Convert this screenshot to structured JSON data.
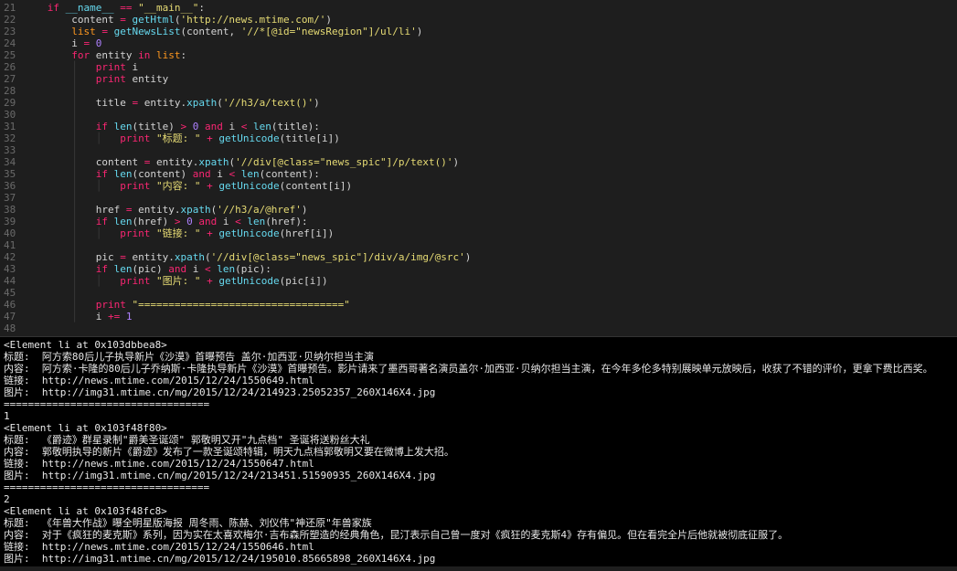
{
  "editor": {
    "lines": [
      {
        "n": "21",
        "html": "    <span class='kw'>if</span> <span class='fn'>__name__</span> <span class='op'>==</span> <span class='str'>\"__main__\"</span>:"
      },
      {
        "n": "22",
        "html": "        content <span class='op'>=</span> <span class='fn'>getHtml</span>(<span class='str'>'http://news.mtime.com/'</span>)"
      },
      {
        "n": "23",
        "html": "        <span class='name'>list</span> <span class='op'>=</span> <span class='fn'>getNewsList</span>(content, <span class='str'>'//*[@id=\"newsRegion\"]/ul/li'</span>)"
      },
      {
        "n": "24",
        "html": "        i <span class='op'>=</span> <span class='num'>0</span>"
      },
      {
        "n": "25",
        "html": "        <span class='kw'>for</span> entity <span class='kw'>in</span> <span class='name'>list</span>:"
      },
      {
        "n": "26",
        "html": "        <span class='guide'>│</span>   <span class='kw'>print</span> i"
      },
      {
        "n": "27",
        "html": "        <span class='guide'>│</span>   <span class='kw'>print</span> entity"
      },
      {
        "n": "28",
        "html": "        <span class='guide'>│</span>"
      },
      {
        "n": "29",
        "html": "        <span class='guide'>│</span>   title <span class='op'>=</span> entity.<span class='fn'>xpath</span>(<span class='str'>'//h3/a/text()'</span>)"
      },
      {
        "n": "30",
        "html": "        <span class='guide'>│</span>"
      },
      {
        "n": "31",
        "html": "        <span class='guide'>│</span>   <span class='kw'>if</span> <span class='fn'>len</span>(title) <span class='op'>&gt;</span> <span class='num'>0</span> <span class='kw'>and</span> i <span class='op'>&lt;</span> <span class='fn'>len</span>(title):"
      },
      {
        "n": "32",
        "html": "        <span class='guide'>│</span>   <span class='guide'>│</span>   <span class='kw'>print</span> <span class='str'>\"标题: \"</span> <span class='op'>+</span> <span class='fn'>getUnicode</span>(title[i])"
      },
      {
        "n": "33",
        "html": "        <span class='guide'>│</span>"
      },
      {
        "n": "34",
        "html": "        <span class='guide'>│</span>   content <span class='op'>=</span> entity.<span class='fn'>xpath</span>(<span class='str'>'//div[@class=\"news_spic\"]/p/text()'</span>)"
      },
      {
        "n": "35",
        "html": "        <span class='guide'>│</span>   <span class='kw'>if</span> <span class='fn'>len</span>(content) <span class='kw'>and</span> i <span class='op'>&lt;</span> <span class='fn'>len</span>(content):"
      },
      {
        "n": "36",
        "html": "        <span class='guide'>│</span>   <span class='guide'>│</span>   <span class='kw'>print</span> <span class='str'>\"内容: \"</span> <span class='op'>+</span> <span class='fn'>getUnicode</span>(content[i])"
      },
      {
        "n": "37",
        "html": "        <span class='guide'>│</span>"
      },
      {
        "n": "38",
        "html": "        <span class='guide'>│</span>   href <span class='op'>=</span> entity.<span class='fn'>xpath</span>(<span class='str'>'//h3/a/@href'</span>)"
      },
      {
        "n": "39",
        "html": "        <span class='guide'>│</span>   <span class='kw'>if</span> <span class='fn'>len</span>(href) <span class='op'>&gt;</span> <span class='num'>0</span> <span class='kw'>and</span> i <span class='op'>&lt;</span> <span class='fn'>len</span>(href):"
      },
      {
        "n": "40",
        "html": "        <span class='guide'>│</span>   <span class='guide'>│</span>   <span class='kw'>print</span> <span class='str'>\"链接: \"</span> <span class='op'>+</span> <span class='fn'>getUnicode</span>(href[i])"
      },
      {
        "n": "41",
        "html": "        <span class='guide'>│</span>"
      },
      {
        "n": "42",
        "html": "        <span class='guide'>│</span>   pic <span class='op'>=</span> entity.<span class='fn'>xpath</span>(<span class='str'>'//div[@class=\"news_spic\"]/div/a/img/@src'</span>)"
      },
      {
        "n": "43",
        "html": "        <span class='guide'>│</span>   <span class='kw'>if</span> <span class='fn'>len</span>(pic) <span class='kw'>and</span> i <span class='op'>&lt;</span> <span class='fn'>len</span>(pic):"
      },
      {
        "n": "44",
        "html": "        <span class='guide'>│</span>   <span class='guide'>│</span>   <span class='kw'>print</span> <span class='str'>\"图片: \"</span> <span class='op'>+</span> <span class='fn'>getUnicode</span>(pic[i])"
      },
      {
        "n": "45",
        "html": "        <span class='guide'>│</span>"
      },
      {
        "n": "46",
        "html": "        <span class='guide'>│</span>   <span class='kw'>print</span> <span class='str'>\"==================================\"</span>"
      },
      {
        "n": "47",
        "html": "        <span class='guide'>│</span>   i <span class='op'>+=</span> <span class='num'>1</span>"
      },
      {
        "n": "48",
        "html": ""
      }
    ]
  },
  "terminal": {
    "lines": [
      "<Element li at 0x103dbbea8>",
      "标题:  阿方索80后儿子执导新片《沙漠》首曝预告 盖尔·加西亚·贝纳尔担当主演",
      "内容:  阿方索·卡隆的80后儿子乔纳斯·卡隆执导新片《沙漠》首曝预告。影片请来了墨西哥著名演员盖尔·加西亚·贝纳尔担当主演，在今年多伦多特别展映单元放映后，收获了不错的评价，更拿下费比西奖。",
      "链接:  http://news.mtime.com/2015/12/24/1550649.html",
      "图片:  http://img31.mtime.cn/mg/2015/12/24/214923.25052357_260X146X4.jpg",
      "==================================",
      "1",
      "<Element li at 0x103f48f80>",
      "标题:  《爵迹》群星录制\"爵美圣诞颂\" 郭敬明又开\"九点档\" 圣诞将送粉丝大礼",
      "内容:  郭敬明执导的新片《爵迹》发布了一款圣诞颂特辑，明天九点档郭敬明又要在微博上发大招。",
      "链接:  http://news.mtime.com/2015/12/24/1550647.html",
      "图片:  http://img31.mtime.cn/mg/2015/12/24/213451.51590935_260X146X4.jpg",
      "==================================",
      "2",
      "<Element li at 0x103f48fc8>",
      "标题:  《年兽大作战》曝全明星版海报 周冬雨、陈赫、刘仪伟\"神还原\"年兽家族",
      "内容:  对于《疯狂的麦克斯》系列，因为实在太喜欢梅尔·吉布森所塑造的经典角色，昆汀表示自己曾一度对《疯狂的麦克斯4》存有偏见。但在看完全片后他就被彻底征服了。",
      "链接:  http://news.mtime.com/2015/12/24/1550646.html",
      "图片:  http://img31.mtime.cn/mg/2015/12/24/195010.85665898_260X146X4.jpg"
    ]
  }
}
